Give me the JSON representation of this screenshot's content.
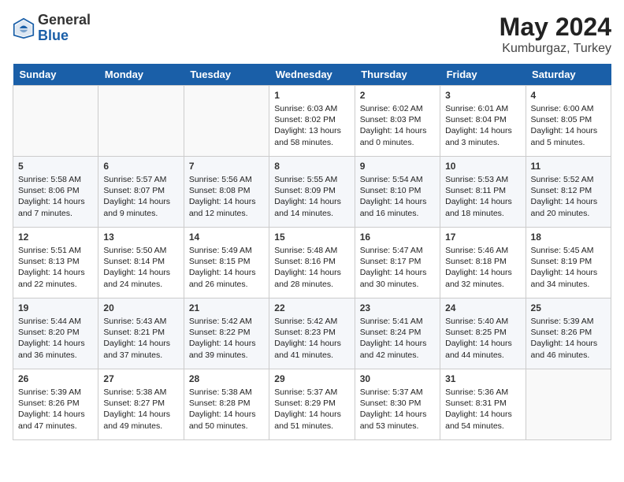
{
  "header": {
    "logo_general": "General",
    "logo_blue": "Blue",
    "month_year": "May 2024",
    "location": "Kumburgaz, Turkey"
  },
  "weekdays": [
    "Sunday",
    "Monday",
    "Tuesday",
    "Wednesday",
    "Thursday",
    "Friday",
    "Saturday"
  ],
  "weeks": [
    [
      {
        "day": "",
        "content": ""
      },
      {
        "day": "",
        "content": ""
      },
      {
        "day": "",
        "content": ""
      },
      {
        "day": "1",
        "content": "Sunrise: 6:03 AM\nSunset: 8:02 PM\nDaylight: 13 hours\nand 58 minutes."
      },
      {
        "day": "2",
        "content": "Sunrise: 6:02 AM\nSunset: 8:03 PM\nDaylight: 14 hours\nand 0 minutes."
      },
      {
        "day": "3",
        "content": "Sunrise: 6:01 AM\nSunset: 8:04 PM\nDaylight: 14 hours\nand 3 minutes."
      },
      {
        "day": "4",
        "content": "Sunrise: 6:00 AM\nSunset: 8:05 PM\nDaylight: 14 hours\nand 5 minutes."
      }
    ],
    [
      {
        "day": "5",
        "content": "Sunrise: 5:58 AM\nSunset: 8:06 PM\nDaylight: 14 hours\nand 7 minutes."
      },
      {
        "day": "6",
        "content": "Sunrise: 5:57 AM\nSunset: 8:07 PM\nDaylight: 14 hours\nand 9 minutes."
      },
      {
        "day": "7",
        "content": "Sunrise: 5:56 AM\nSunset: 8:08 PM\nDaylight: 14 hours\nand 12 minutes."
      },
      {
        "day": "8",
        "content": "Sunrise: 5:55 AM\nSunset: 8:09 PM\nDaylight: 14 hours\nand 14 minutes."
      },
      {
        "day": "9",
        "content": "Sunrise: 5:54 AM\nSunset: 8:10 PM\nDaylight: 14 hours\nand 16 minutes."
      },
      {
        "day": "10",
        "content": "Sunrise: 5:53 AM\nSunset: 8:11 PM\nDaylight: 14 hours\nand 18 minutes."
      },
      {
        "day": "11",
        "content": "Sunrise: 5:52 AM\nSunset: 8:12 PM\nDaylight: 14 hours\nand 20 minutes."
      }
    ],
    [
      {
        "day": "12",
        "content": "Sunrise: 5:51 AM\nSunset: 8:13 PM\nDaylight: 14 hours\nand 22 minutes."
      },
      {
        "day": "13",
        "content": "Sunrise: 5:50 AM\nSunset: 8:14 PM\nDaylight: 14 hours\nand 24 minutes."
      },
      {
        "day": "14",
        "content": "Sunrise: 5:49 AM\nSunset: 8:15 PM\nDaylight: 14 hours\nand 26 minutes."
      },
      {
        "day": "15",
        "content": "Sunrise: 5:48 AM\nSunset: 8:16 PM\nDaylight: 14 hours\nand 28 minutes."
      },
      {
        "day": "16",
        "content": "Sunrise: 5:47 AM\nSunset: 8:17 PM\nDaylight: 14 hours\nand 30 minutes."
      },
      {
        "day": "17",
        "content": "Sunrise: 5:46 AM\nSunset: 8:18 PM\nDaylight: 14 hours\nand 32 minutes."
      },
      {
        "day": "18",
        "content": "Sunrise: 5:45 AM\nSunset: 8:19 PM\nDaylight: 14 hours\nand 34 minutes."
      }
    ],
    [
      {
        "day": "19",
        "content": "Sunrise: 5:44 AM\nSunset: 8:20 PM\nDaylight: 14 hours\nand 36 minutes."
      },
      {
        "day": "20",
        "content": "Sunrise: 5:43 AM\nSunset: 8:21 PM\nDaylight: 14 hours\nand 37 minutes."
      },
      {
        "day": "21",
        "content": "Sunrise: 5:42 AM\nSunset: 8:22 PM\nDaylight: 14 hours\nand 39 minutes."
      },
      {
        "day": "22",
        "content": "Sunrise: 5:42 AM\nSunset: 8:23 PM\nDaylight: 14 hours\nand 41 minutes."
      },
      {
        "day": "23",
        "content": "Sunrise: 5:41 AM\nSunset: 8:24 PM\nDaylight: 14 hours\nand 42 minutes."
      },
      {
        "day": "24",
        "content": "Sunrise: 5:40 AM\nSunset: 8:25 PM\nDaylight: 14 hours\nand 44 minutes."
      },
      {
        "day": "25",
        "content": "Sunrise: 5:39 AM\nSunset: 8:26 PM\nDaylight: 14 hours\nand 46 minutes."
      }
    ],
    [
      {
        "day": "26",
        "content": "Sunrise: 5:39 AM\nSunset: 8:26 PM\nDaylight: 14 hours\nand 47 minutes."
      },
      {
        "day": "27",
        "content": "Sunrise: 5:38 AM\nSunset: 8:27 PM\nDaylight: 14 hours\nand 49 minutes."
      },
      {
        "day": "28",
        "content": "Sunrise: 5:38 AM\nSunset: 8:28 PM\nDaylight: 14 hours\nand 50 minutes."
      },
      {
        "day": "29",
        "content": "Sunrise: 5:37 AM\nSunset: 8:29 PM\nDaylight: 14 hours\nand 51 minutes."
      },
      {
        "day": "30",
        "content": "Sunrise: 5:37 AM\nSunset: 8:30 PM\nDaylight: 14 hours\nand 53 minutes."
      },
      {
        "day": "31",
        "content": "Sunrise: 5:36 AM\nSunset: 8:31 PM\nDaylight: 14 hours\nand 54 minutes."
      },
      {
        "day": "",
        "content": ""
      }
    ]
  ]
}
